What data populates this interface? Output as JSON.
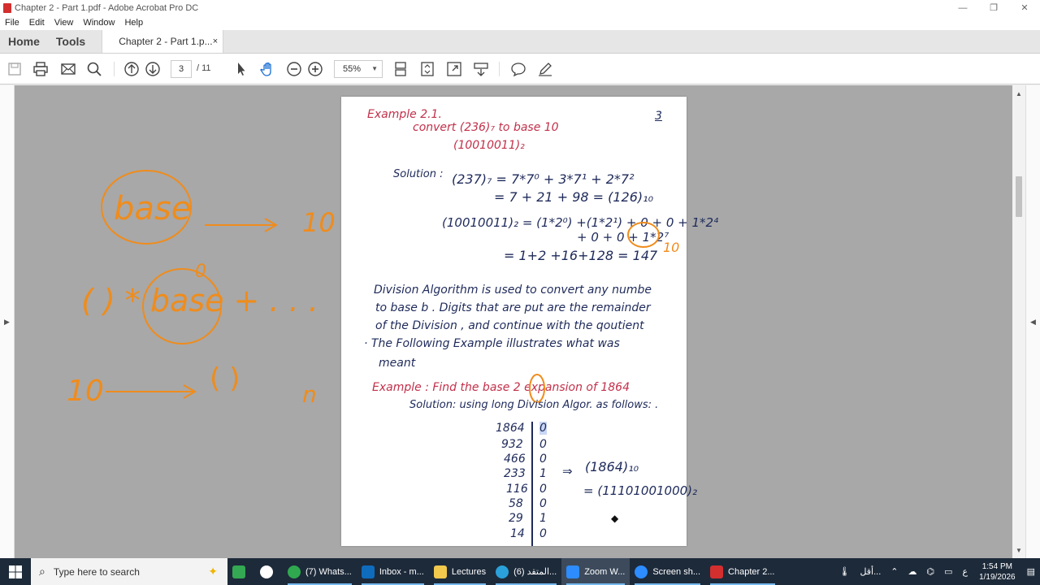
{
  "window": {
    "title": "Chapter 2 - Part 1.pdf - Adobe Acrobat Pro DC",
    "minimize": "—",
    "restore": "❐",
    "close": "✕"
  },
  "menu": [
    "File",
    "Edit",
    "View",
    "Window",
    "Help"
  ],
  "tabs": {
    "home": "Home",
    "tools": "Tools",
    "document": "Chapter 2 - Part 1.p...",
    "close": "×"
  },
  "toolbar": {
    "page_current": "3",
    "page_total": "/ 11",
    "zoom": "55%"
  },
  "pdf_page": {
    "page_number": "3",
    "example1_title": "Example 2.1.",
    "example1_line1": "convert  (236)₇      to  base  10",
    "example1_line2": "(10010011)₂",
    "solution_label": "Solution :",
    "eq1": "(237)₇ =  7*7⁰ + 3*7¹ + 2*7²",
    "eq2": "=  7 + 21 + 98  =  (126)₁₀",
    "eq3": "(10010011)₂ = (1*2⁰) +(1*2¹) + 0  + 0 + 1*2⁴",
    "eq4": "+ 0 + 0 + 1*2⁷",
    "eq5": "=  1+2 +16+128  =  147",
    "para1": "Division  Algorithm  is  used  to  convert  any  numbe",
    "para2": "to  base b .  Digits  that  are  put  are  the  remainder",
    "para3": "of  the  Division ,  and  continue  with  the  qoutient",
    "para4": "· The  Following  Example  illustrates  what  was",
    "para5": "meant",
    "example2_title": "Example :  Find  the  base  2  expansion  of  1864",
    "example2_solution": "Solution:  using  long  Division  Algor.  as follows: .",
    "division_quotients": [
      "1864",
      "932",
      "466",
      "233",
      "116",
      "58",
      "29",
      "14"
    ],
    "division_remainders": [
      "0",
      "0",
      "0",
      "1",
      "0",
      "0",
      "1",
      "0"
    ],
    "result_arrow": "⇒",
    "result_lhs": "(1864)₁₀",
    "result_rhs": "= (11101001000)₂"
  },
  "annotations": {
    "base_word": "base",
    "arrow_target": "10",
    "ten_suffix": "10",
    "formula": "( ) * base + . . .",
    "exponent": "0",
    "conversion_from": "10",
    "conversion_to": "(     )",
    "conversion_sub": "n"
  },
  "taskbar": {
    "search_placeholder": "Type here to search",
    "apps": [
      {
        "label": "(7) Whats...",
        "color": "#2fa84f"
      },
      {
        "label": "Inbox - m...",
        "color": "#0f6cbd"
      },
      {
        "label": "Lectures",
        "color": "#f2c94c"
      },
      {
        "label": "(6) المتقد...",
        "color": "#2aa1da"
      },
      {
        "label": "Zoom W...",
        "color": "#2d8cff"
      },
      {
        "label": "Screen sh...",
        "color": "#2d8cff"
      },
      {
        "label": "Chapter 2...",
        "color": "#d32f2f"
      }
    ],
    "tray_text": "أقل...",
    "lang": "ع",
    "time": "1:54 PM",
    "date": "1/19/2026"
  },
  "colors": {
    "ink_red": "#c2304a",
    "ink_blue": "#1e2a5a",
    "annotation_orange": "#ef8c1c"
  }
}
